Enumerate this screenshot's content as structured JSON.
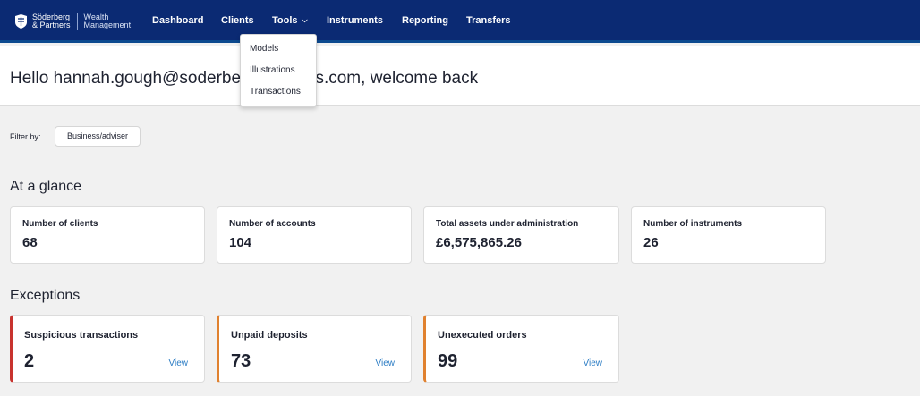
{
  "brand": {
    "name_line1": "Söderberg",
    "name_line2": "& Partners",
    "sub_line1": "Wealth",
    "sub_line2": "Management"
  },
  "nav": {
    "items": [
      {
        "label": "Dashboard"
      },
      {
        "label": "Clients"
      },
      {
        "label": "Tools"
      },
      {
        "label": "Instruments"
      },
      {
        "label": "Reporting"
      },
      {
        "label": "Transfers"
      }
    ],
    "tools_menu": [
      "Models",
      "Illustrations",
      "Transactions"
    ]
  },
  "welcome": {
    "text": "Hello hannah.gough@soderberg-partners.com, welcome back"
  },
  "filter": {
    "label": "Filter by:",
    "button": "Business/adviser"
  },
  "glance": {
    "title": "At a glance",
    "cards": [
      {
        "label": "Number of clients",
        "value": "68"
      },
      {
        "label": "Number of accounts",
        "value": "104"
      },
      {
        "label": "Total assets under administration",
        "value": "£6,575,865.26"
      },
      {
        "label": "Number of instruments",
        "value": "26"
      }
    ]
  },
  "exceptions": {
    "title": "Exceptions",
    "view_label": "View",
    "cards": [
      {
        "label": "Suspicious transactions",
        "value": "2"
      },
      {
        "label": "Unpaid deposits",
        "value": "73"
      },
      {
        "label": "Unexecuted orders",
        "value": "99"
      }
    ]
  },
  "colors": {
    "nav_bg": "#0b2a73",
    "accent_orange": "#e0812f",
    "accent_red": "#c8332e",
    "link": "#2b7cc4"
  }
}
